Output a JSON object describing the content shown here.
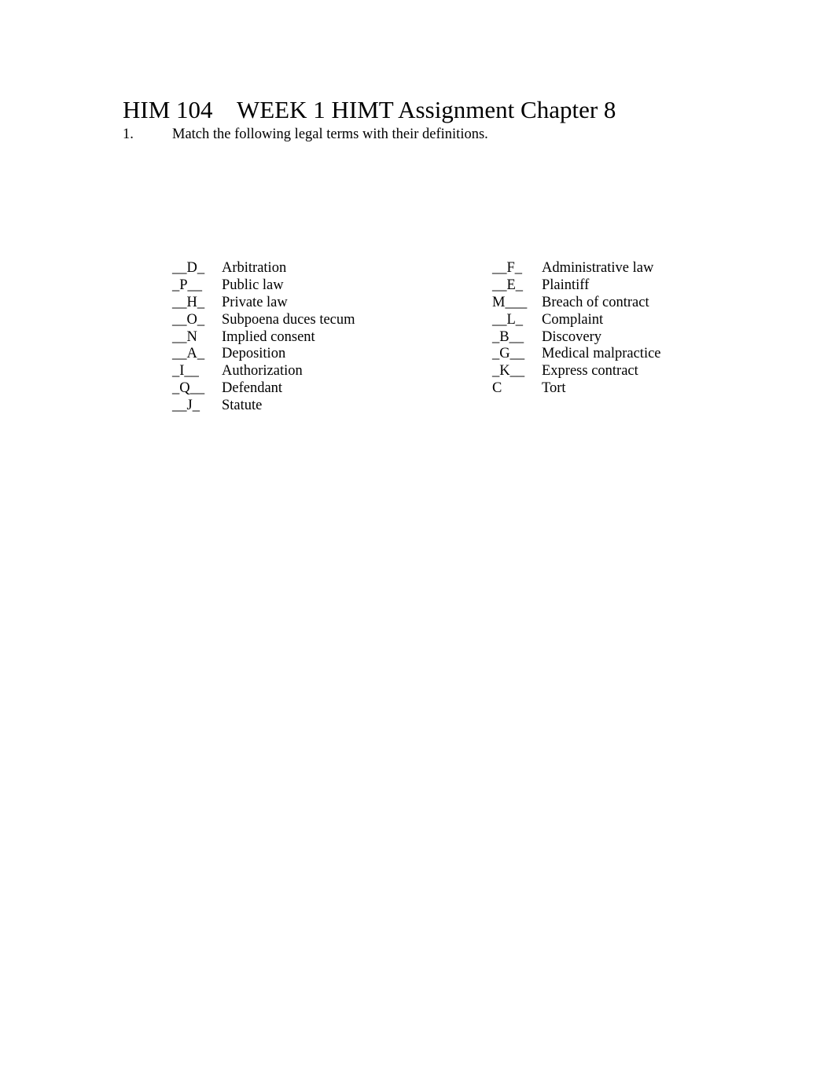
{
  "document": {
    "title": "HIM 104    WEEK 1 HIMT Assignment Chapter 8",
    "question": {
      "number": "1.",
      "prompt": "Match the following legal terms with their definitions."
    },
    "left_column": [
      {
        "answer": "__D_",
        "term": "Arbitration"
      },
      {
        "answer": "_P__",
        "term": "Public law"
      },
      {
        "answer": "__H_",
        "term": "Private law"
      },
      {
        "answer": "__O_",
        "term": "Subpoena duces tecum"
      },
      {
        "answer": "__N",
        "term": "Implied consent"
      },
      {
        "answer": "__A_",
        "term": "Deposition"
      },
      {
        "answer": "_I__",
        "term": "Authorization"
      },
      {
        "answer": "_Q__",
        "term": "Defendant"
      },
      {
        "answer": "__J_",
        "term": "Statute"
      }
    ],
    "right_column": [
      {
        "answer": "__F_",
        "term": "Administrative law"
      },
      {
        "answer": "__E_",
        "term": "Plaintiff"
      },
      {
        "answer": "M___",
        "term": "Breach of contract"
      },
      {
        "answer": "__L_",
        "term": "Complaint"
      },
      {
        "answer": "_B__",
        "term": "Discovery"
      },
      {
        "answer": "_G__",
        "term": "Medical malpractice"
      },
      {
        "answer": "_K__",
        "term": "Express contract"
      },
      {
        "answer": "C",
        "term": "Tort"
      }
    ]
  }
}
